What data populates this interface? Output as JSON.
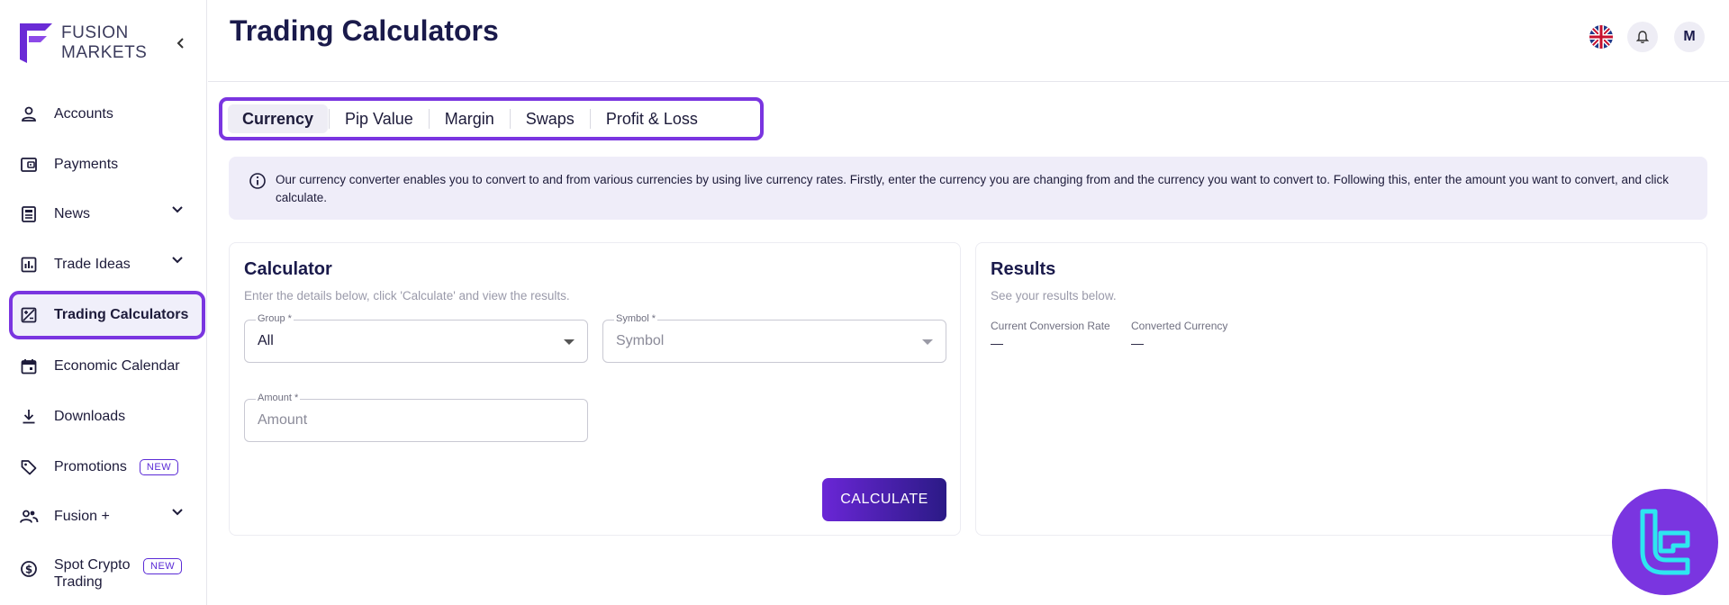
{
  "brand": {
    "line1": "FUSION",
    "line2": "MARKETS"
  },
  "sidebar": {
    "items": [
      {
        "label": "Accounts",
        "icon": "user-icon"
      },
      {
        "label": "Payments",
        "icon": "wallet-icon"
      },
      {
        "label": "News",
        "icon": "newspaper-icon",
        "expandable": true
      },
      {
        "label": "Trade Ideas",
        "icon": "bar-chart-icon",
        "expandable": true
      },
      {
        "label": "Trading Calculators",
        "icon": "calculator-icon",
        "active": true
      },
      {
        "label": "Economic Calendar",
        "icon": "calendar-icon"
      },
      {
        "label": "Downloads",
        "icon": "download-icon"
      },
      {
        "label": "Promotions",
        "icon": "tag-icon",
        "badge": "NEW"
      },
      {
        "label": "Fusion +",
        "icon": "group-icon",
        "expandable": true
      },
      {
        "label": "Spot Crypto Trading",
        "label_line1": "Spot Crypto",
        "label_line2": "Trading",
        "icon": "crypto-icon",
        "badge": "NEW"
      }
    ]
  },
  "header": {
    "title": "Trading Calculators",
    "avatar_initial": "M"
  },
  "tabs": [
    {
      "label": "Currency",
      "active": true
    },
    {
      "label": "Pip Value"
    },
    {
      "label": "Margin"
    },
    {
      "label": "Swaps"
    },
    {
      "label": "Profit & Loss"
    }
  ],
  "info": {
    "text": "Our currency converter enables you to convert to and from various currencies by using live currency rates. Firstly, enter the currency you are changing from and the currency you want to convert to. Following this, enter the amount you want to convert, and click calculate."
  },
  "calculator": {
    "title": "Calculator",
    "subtitle": "Enter the details below, click 'Calculate' and view the results.",
    "group": {
      "label": "Group *",
      "value": "All"
    },
    "symbol": {
      "label": "Symbol *",
      "placeholder": "Symbol"
    },
    "amount": {
      "label": "Amount *",
      "placeholder": "Amount"
    },
    "button": "CALCULATE"
  },
  "results": {
    "title": "Results",
    "subtitle": "See your results below.",
    "rate": {
      "label": "Current Conversion Rate",
      "value": "—"
    },
    "converted": {
      "label": "Converted Currency",
      "value": "—"
    }
  },
  "colors": {
    "accent": "#7a35e0",
    "navy": "#1a1a4b",
    "info_bg": "#efedf9"
  }
}
